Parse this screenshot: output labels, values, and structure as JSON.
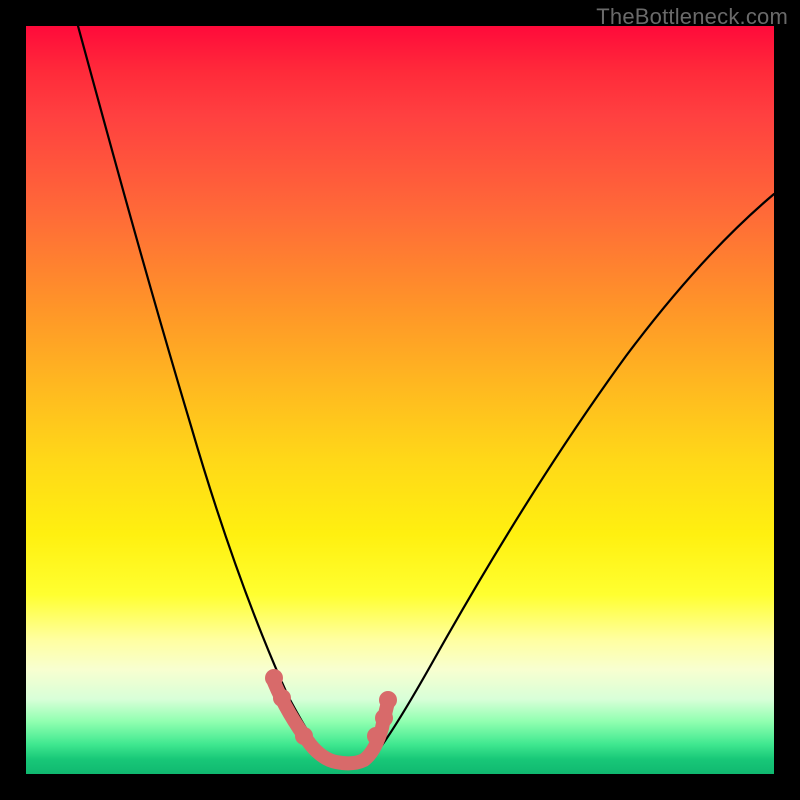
{
  "watermark": {
    "text": "TheBottleneck.com"
  },
  "chart_data": {
    "type": "line",
    "title": "",
    "xlabel": "",
    "ylabel": "",
    "xlim": [
      0,
      100
    ],
    "ylim": [
      0,
      100
    ],
    "grid": false,
    "legend": false,
    "series": [
      {
        "name": "bottleneck-curve",
        "x": [
          7,
          10,
          14,
          18,
          22,
          26,
          30,
          33,
          35,
          37,
          39,
          41,
          43,
          46,
          50,
          55,
          60,
          68,
          78,
          90,
          100
        ],
        "values": [
          100,
          85,
          70,
          56,
          44,
          33,
          23,
          15,
          10,
          6,
          3,
          2,
          2,
          3,
          6,
          12,
          20,
          33,
          48,
          63,
          74
        ],
        "color": "#000000"
      },
      {
        "name": "optimal-zone-overlay",
        "x": [
          33,
          35,
          37,
          39,
          41,
          43,
          44,
          45,
          46,
          47
        ],
        "values": [
          11.5,
          7,
          4,
          2,
          1.5,
          1.5,
          2,
          3,
          5,
          8
        ],
        "color": "#d86a6a"
      }
    ],
    "annotations": [
      {
        "type": "dot",
        "x": 33,
        "y": 12,
        "color": "#d86a6a"
      },
      {
        "type": "dot",
        "x": 35,
        "y": 7,
        "color": "#d86a6a"
      },
      {
        "type": "dot",
        "x": 37,
        "y": 3,
        "color": "#d86a6a"
      },
      {
        "type": "dot",
        "x": 45,
        "y": 3,
        "color": "#d86a6a"
      },
      {
        "type": "dot",
        "x": 46,
        "y": 5,
        "color": "#d86a6a"
      },
      {
        "type": "dot",
        "x": 47,
        "y": 8,
        "color": "#d86a6a"
      }
    ]
  }
}
